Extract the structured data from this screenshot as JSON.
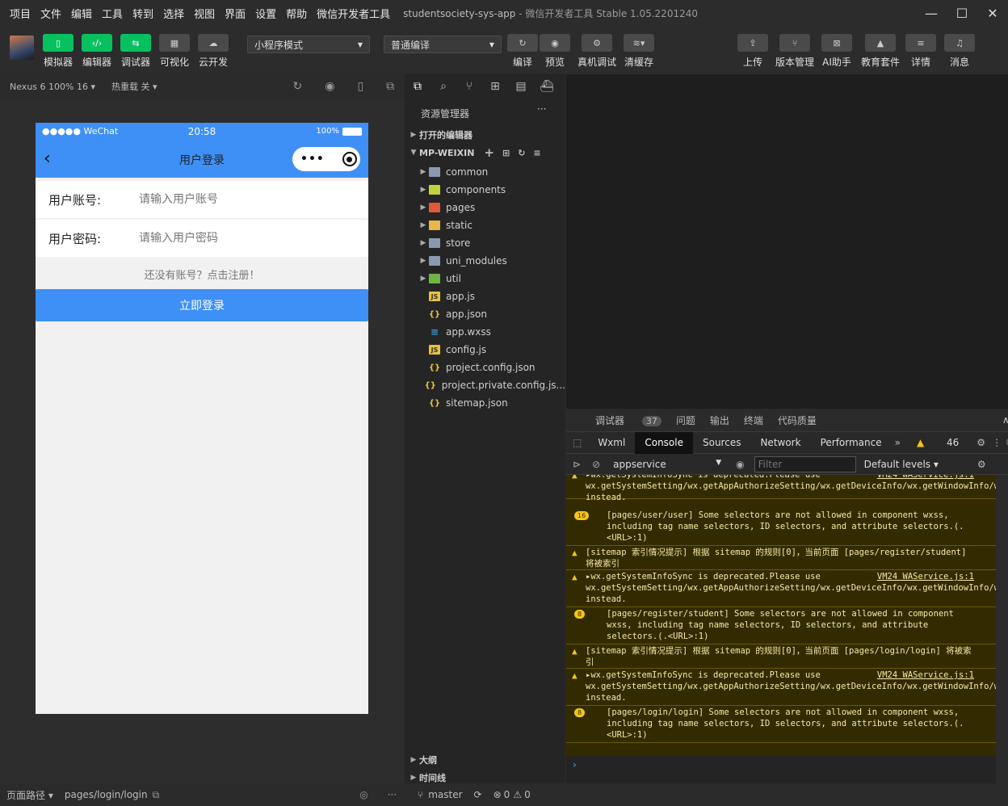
{
  "titlebar": {
    "menus": [
      "项目",
      "文件",
      "编辑",
      "工具",
      "转到",
      "选择",
      "视图",
      "界面",
      "设置",
      "帮助",
      "微信开发者工具"
    ],
    "window_title": "studentsociety-sys-app",
    "app_info": "- 微信开发者工具 Stable 1.05.2201240",
    "controls": [
      "—",
      "☐",
      "✕"
    ]
  },
  "toolbar": {
    "left_buttons": [
      {
        "label": "模拟器",
        "icon": "phone-icon",
        "glyph": "▯"
      },
      {
        "label": "编辑器",
        "icon": "code-icon",
        "glyph": "‹/›"
      },
      {
        "label": "调试器",
        "icon": "debug-icon",
        "glyph": "⇆"
      },
      {
        "label": "可视化",
        "icon": "layout-icon",
        "glyph": "▦"
      },
      {
        "label": "云开发",
        "icon": "cloud-icon",
        "glyph": "☁"
      }
    ],
    "mode_select": "小程序模式",
    "compile_select": "普通编译",
    "mid_buttons": [
      {
        "label": "编译",
        "icon": "refresh-icon",
        "glyph": "↻"
      },
      {
        "label": "预览",
        "icon": "eye-icon",
        "glyph": "◉"
      },
      {
        "label": "真机调试",
        "icon": "bug-icon",
        "glyph": "⚙"
      },
      {
        "label": "清缓存",
        "icon": "layers-icon",
        "glyph": "≋▾"
      }
    ],
    "right_buttons": [
      {
        "label": "上传",
        "icon": "upload-icon",
        "glyph": "⇪"
      },
      {
        "label": "版本管理",
        "icon": "git-icon",
        "glyph": "⑂"
      },
      {
        "label": "AI助手",
        "icon": "ai-icon",
        "glyph": "⊠"
      },
      {
        "label": "教育套件",
        "icon": "graduation-icon",
        "glyph": "▲"
      },
      {
        "label": "详情",
        "icon": "menu-icon",
        "glyph": "≡"
      },
      {
        "label": "消息",
        "icon": "bell-icon",
        "glyph": "♫"
      }
    ]
  },
  "simulator": {
    "device": "Nexus 6 100% 16 ▾",
    "hot_reload": "热重载 关 ▾",
    "status_bar": {
      "left": "●●●●● WeChat",
      "time": "20:58",
      "battery": "100%"
    },
    "nav_title": "用户登录",
    "form": {
      "account_label": "用户账号:",
      "account_placeholder": "请输入用户账号",
      "password_label": "用户密码:",
      "password_placeholder": "请输入用户密码",
      "register_tip": "还没有账号？点击注册！",
      "login_button": "立即登录"
    },
    "bottom": {
      "page_path_label": "页面路径 ▾",
      "page_path": "pages/login/login"
    }
  },
  "explorer": {
    "title": "资源管理器",
    "open_editors": "打开的编辑器",
    "root": "MP-WEIXIN",
    "items": [
      {
        "name": "common",
        "type": "folder",
        "color": "#8a9bb0"
      },
      {
        "name": "components",
        "type": "folder",
        "color": "#c0d43a"
      },
      {
        "name": "pages",
        "type": "folder",
        "color": "#e3573c"
      },
      {
        "name": "static",
        "type": "folder",
        "color": "#e8b64a"
      },
      {
        "name": "store",
        "type": "folder",
        "color": "#8a9bb0"
      },
      {
        "name": "uni_modules",
        "type": "folder",
        "color": "#8a9bb0"
      },
      {
        "name": "util",
        "type": "folder",
        "color": "#6fb544"
      },
      {
        "name": "app.js",
        "type": "js",
        "color": "#e8c43a"
      },
      {
        "name": "app.json",
        "type": "json",
        "color": "#e8c43a"
      },
      {
        "name": "app.wxss",
        "type": "css",
        "color": "#3c99dc"
      },
      {
        "name": "config.js",
        "type": "js",
        "color": "#e8c43a"
      },
      {
        "name": "project.config.json",
        "type": "json",
        "color": "#e8c43a"
      },
      {
        "name": "project.private.config.js...",
        "type": "json",
        "color": "#e8c43a"
      },
      {
        "name": "sitemap.json",
        "type": "json",
        "color": "#e8c43a"
      }
    ],
    "outline": "大纲",
    "timeline": "时间线"
  },
  "devtools": {
    "top_tabs": [
      {
        "label": "调试器",
        "badge": "37"
      },
      {
        "label": "问题"
      },
      {
        "label": "输出"
      },
      {
        "label": "终端"
      },
      {
        "label": "代码质量"
      }
    ],
    "tabs": [
      "Wxml",
      "Console",
      "Sources",
      "Network",
      "Performance"
    ],
    "active_tab": "Console",
    "warn_count": "46",
    "context": "appservice",
    "filter_placeholder": "Filter",
    "levels": "Default levels ▾",
    "messages": [
      {
        "kind": "warn",
        "text": "▸wx.getSystemInfoSync is deprecated.Please use wx.getSystemSetting/wx.getAppAuthorizeSetting/wx.getDeviceInfo/wx.getWindowInfo/wx.getAppBaseInfo instead.",
        "src": "VM24 WAService.js:1"
      },
      {
        "kind": "count",
        "count": "16",
        "text": "[pages/user/user] Some selectors are not allowed in component wxss, including tag name selectors, ID selectors, and attribute selectors.(.<URL>:1)"
      },
      {
        "kind": "warn",
        "text": "[sitemap 索引情况提示] 根据 sitemap 的规则[0]，当前页面 [pages/register/student] 将被索引"
      },
      {
        "kind": "warn",
        "text": "▸wx.getSystemInfoSync is deprecated.Please use wx.getSystemSetting/wx.getAppAuthorizeSetting/wx.getDeviceInfo/wx.getWindowInfo/wx.getAppBaseInfo instead.",
        "src": "VM24 WAService.js:1"
      },
      {
        "kind": "count",
        "count": "8",
        "text": "[pages/register/student] Some selectors are not allowed in component wxss, including tag name selectors, ID selectors, and attribute selectors.(.<URL>:1)"
      },
      {
        "kind": "warn",
        "text": "[sitemap 索引情况提示] 根据 sitemap 的规则[0]，当前页面 [pages/login/login] 将被索引"
      },
      {
        "kind": "warn",
        "text": "▸wx.getSystemInfoSync is deprecated.Please use wx.getSystemSetting/wx.getAppAuthorizeSetting/wx.getDeviceInfo/wx.getWindowInfo/wx.getAppBaseInfo instead.",
        "src": "VM24 WAService.js:1"
      },
      {
        "kind": "count",
        "count": "8",
        "text": "[pages/login/login] Some selectors are not allowed in component wxss, including tag name selectors, ID selectors, and attribute selectors.(.<URL>:1)"
      }
    ],
    "prompt": "›"
  },
  "statusbar": {
    "branch": "master",
    "errors": "0",
    "warnings": "0"
  }
}
